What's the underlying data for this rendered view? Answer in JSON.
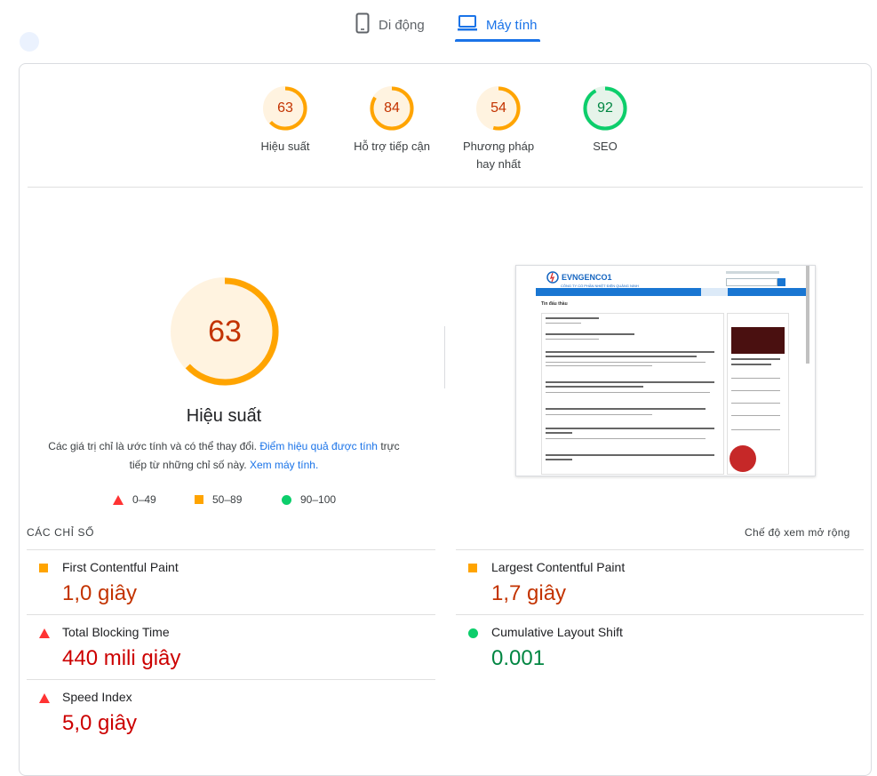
{
  "tabs": [
    {
      "label": "Di động",
      "icon": "mobile-icon",
      "active": false
    },
    {
      "label": "Máy tính",
      "icon": "laptop-icon",
      "active": true
    }
  ],
  "categories": [
    {
      "label": "Hiệu suất",
      "score": 63,
      "color": "#ffa400"
    },
    {
      "label": "Hỗ trợ tiếp cận",
      "score": 84,
      "color": "#ffa400"
    },
    {
      "label": "Phương pháp hay nhất",
      "score": 54,
      "color": "#ffa400"
    },
    {
      "label": "SEO",
      "score": 92,
      "color": "#0cce6b"
    }
  ],
  "main": {
    "score": 63,
    "title": "Hiệu suất",
    "desc_prefix": "Các giá trị chỉ là ước tính và có thể thay đổi.",
    "desc_link1": "Điểm hiệu quả được tính",
    "desc_mid": "trực tiếp từ những chỉ số này.",
    "desc_link2": "Xem máy tính.",
    "legend": [
      {
        "range": "0–49",
        "icon": "triangle-icon"
      },
      {
        "range": "50–89",
        "icon": "square-icon"
      },
      {
        "range": "90–100",
        "icon": "circle-icon"
      }
    ]
  },
  "preview": {
    "brand": "EVNGENCO1",
    "company": "CÔNG TY CỔ PHẦN NHIỆT ĐIỆN QUẢNG NINH",
    "section": "Tin đấu thầu"
  },
  "metrics": {
    "header": "CÁC CHỈ SỐ",
    "expand": "Chế độ xem mở rộng",
    "items": [
      {
        "name": "First Contentful Paint",
        "value": "1,0 giây",
        "status": "average"
      },
      {
        "name": "Largest Contentful Paint",
        "value": "1,7 giây",
        "status": "average"
      },
      {
        "name": "Total Blocking Time",
        "value": "440 mili giây",
        "status": "fail"
      },
      {
        "name": "Cumulative Layout Shift",
        "value": "0.001",
        "status": "pass"
      },
      {
        "name": "Speed Index",
        "value": "5,0 giây",
        "status": "fail"
      }
    ]
  },
  "colors": {
    "accent": "#1a73e8",
    "average": "#ffa400",
    "fail": "#ff3333",
    "pass": "#0cce6b"
  }
}
